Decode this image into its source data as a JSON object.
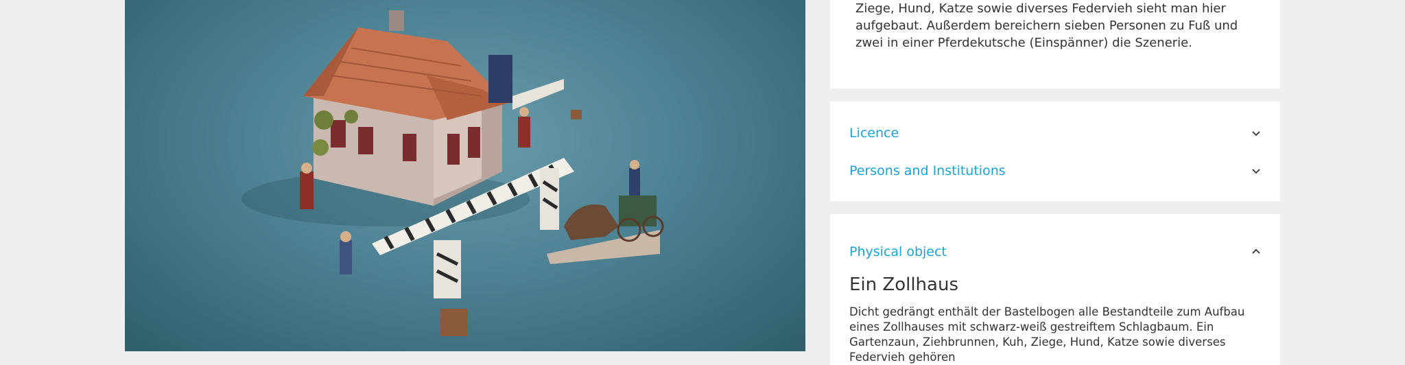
{
  "description": {
    "text": "Ziege, Hund, Katze sowie diverses Federvieh sieht man hier aufgebaut. Außerdem bereichern sieben Personen zu Fuß und zwei in einer Pferdekutsche (Einspänner) die Szenerie."
  },
  "accordion": {
    "licence_label": "Licence",
    "persons_label": "Persons and Institutions",
    "physical_label": "Physical object"
  },
  "physical_object": {
    "title": "Ein Zollhaus",
    "text": "Dicht gedrängt enthält der Bastelbogen alle Bestandteile zum Aufbau eines Zollhauses mit schwarz-weiß gestreiftem Schlagbaum. Ein Gartenzaun, Ziehbrunnen, Kuh, Ziege, Hund, Katze sowie diverses Federvieh gehören"
  },
  "colors": {
    "accent": "#1aa3d6",
    "text": "#333333",
    "page_bg": "#efefef",
    "viewer_bg": "#4d8294"
  },
  "icons": {
    "licence": "chevron-down-icon",
    "persons": "chevron-down-icon",
    "physical": "chevron-up-icon"
  }
}
